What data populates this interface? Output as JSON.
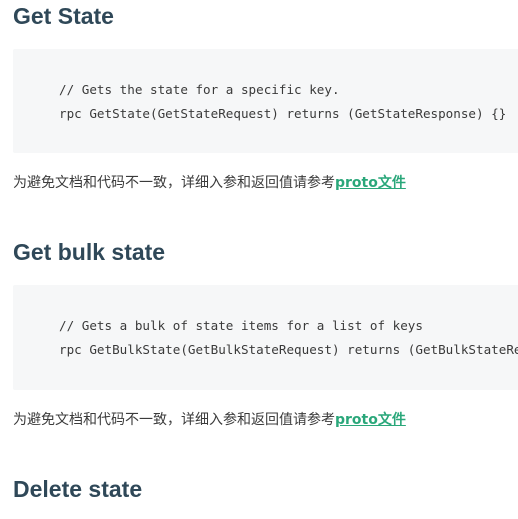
{
  "sections": [
    {
      "heading": "Get State",
      "code_lines": [
        "// Gets the state for a specific key.",
        "rpc GetState(GetStateRequest) returns (GetStateResponse) {}"
      ],
      "note_text": "为避免文档和代码不一致，详细入参和返回值请参考",
      "note_link": "proto文件"
    },
    {
      "heading": "Get bulk state",
      "code_lines": [
        "// Gets a bulk of state items for a list of keys",
        "rpc GetBulkState(GetBulkStateRequest) returns (GetBulkStateResponse) {}"
      ],
      "note_text": "为避免文档和代码不一致，详细入参和返回值请参考",
      "note_link": "proto文件"
    },
    {
      "heading": "Delete state"
    }
  ]
}
